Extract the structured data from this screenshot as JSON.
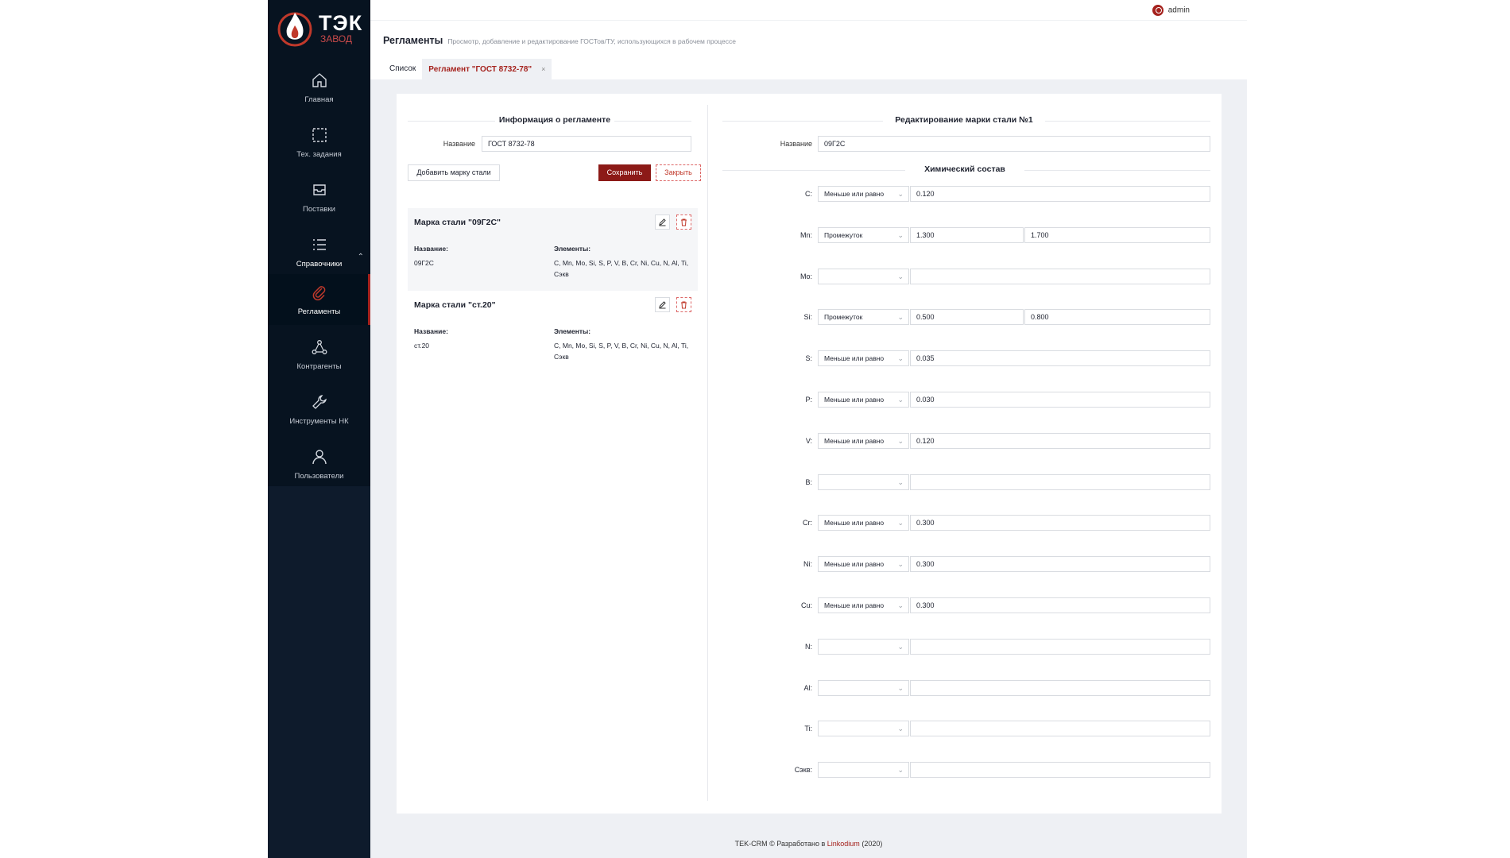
{
  "brand": {
    "logo_text": "ТЭК",
    "logo_sub": "ЗАВОД",
    "brand_color": "#a5221d",
    "sidebar_color": "#0e1b2c"
  },
  "sidebar": {
    "items": [
      {
        "label": "Главная",
        "icon": "home-icon"
      },
      {
        "label": "Тех. задания",
        "icon": "selection-icon"
      },
      {
        "label": "Поставки",
        "icon": "inbox-icon"
      },
      {
        "label": "Справочники",
        "icon": "list-icon"
      },
      {
        "label": "Регламенты",
        "icon": "paperclip-icon",
        "active": true
      },
      {
        "label": "Контрагенты",
        "icon": "network-icon"
      },
      {
        "label": "Инструменты НК",
        "icon": "wrench-icon"
      },
      {
        "label": "Пользователи",
        "icon": "user-icon"
      }
    ]
  },
  "header": {
    "user": "admin"
  },
  "page": {
    "title": "Регламенты",
    "subtitle": "Просмотр, добавление и редактирование ГОСТов/ТУ, использующихся в рабочем процессе"
  },
  "tabs": [
    {
      "label": "Список"
    },
    {
      "label": "Регламент \"ГОСТ 8732-78\"",
      "close": "×"
    }
  ],
  "left": {
    "section_title": "Информация о регламенте",
    "name_label": "Название",
    "name_value": "ГОСТ 8732-78",
    "add_button": "Добавить марку стали",
    "save_button": "Сохранить",
    "close_button": "Закрыть",
    "grades": [
      {
        "title": "Марка стали \"09Г2С\"",
        "name_head": "Название:",
        "name": "09Г2С",
        "elements_head": "Элементы:",
        "elements_line1": "C, Mn, Mo, Si, S, P, V, B, Cr, Ni, Cu, N, Al, Ti,",
        "elements_line2": "Сэкв"
      },
      {
        "title": "Марка стали \"ст.20\"",
        "name_head": "Название:",
        "name": "ст.20",
        "elements_head": "Элементы:",
        "elements_line1": "C, Mn, Mo, Si, S, P, V, B, Cr, Ni, Cu, N, Al, Ti,",
        "elements_line2": "Сэкв"
      }
    ]
  },
  "right": {
    "section_title": "Редактирование марки стали №1",
    "name_label": "Название",
    "name_value": "09Г2С",
    "chem_title": "Химический состав",
    "elements": [
      {
        "label": "C:",
        "mode": "Меньше или равно",
        "v1": "0.120",
        "v2": null
      },
      {
        "label": "Mn:",
        "mode": "Промежуток",
        "v1": "1.300",
        "v2": "1.700"
      },
      {
        "label": "Mo:",
        "mode": "",
        "v1": "",
        "v2": null
      },
      {
        "label": "Si:",
        "mode": "Промежуток",
        "v1": "0.500",
        "v2": "0.800"
      },
      {
        "label": "S:",
        "mode": "Меньше или равно",
        "v1": "0.035",
        "v2": null
      },
      {
        "label": "P:",
        "mode": "Меньше или равно",
        "v1": "0.030",
        "v2": null
      },
      {
        "label": "V:",
        "mode": "Меньше или равно",
        "v1": "0.120",
        "v2": null
      },
      {
        "label": "B:",
        "mode": "",
        "v1": "",
        "v2": null
      },
      {
        "label": "Cr:",
        "mode": "Меньше или равно",
        "v1": "0.300",
        "v2": null
      },
      {
        "label": "Ni:",
        "mode": "Меньше или равно",
        "v1": "0.300",
        "v2": null
      },
      {
        "label": "Cu:",
        "mode": "Меньше или равно",
        "v1": "0.300",
        "v2": null
      },
      {
        "label": "N:",
        "mode": "",
        "v1": "",
        "v2": null
      },
      {
        "label": "Al:",
        "mode": "",
        "v1": "",
        "v2": null
      },
      {
        "label": "Ti:",
        "mode": "",
        "v1": "",
        "v2": null
      },
      {
        "label": "Сэкв:",
        "mode": "",
        "v1": "",
        "v2": null
      }
    ]
  },
  "footer": {
    "prefix": "TEK-CRM © Разработано в",
    "link": "Linkodium",
    "suffix": "(2020)"
  }
}
